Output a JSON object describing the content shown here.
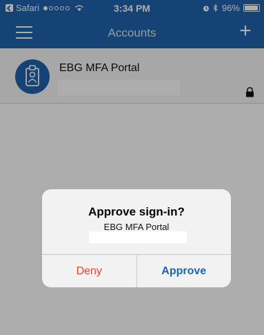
{
  "statusbar": {
    "back_app": "Safari",
    "time": "3:34 PM",
    "battery": "96%",
    "battery_level": 0.96
  },
  "navbar": {
    "title": "Accounts",
    "menu_icon": "hamburger-menu-icon",
    "add_icon": "plus-icon",
    "add_label": "+"
  },
  "account": {
    "name": "EBG MFA Portal",
    "avatar_icon": "id-badge-icon",
    "lock_icon": "lock-icon"
  },
  "dialog": {
    "title": "Approve sign-in?",
    "message": "EBG MFA Portal",
    "deny_label": "Deny",
    "approve_label": "Approve"
  },
  "colors": {
    "brand_blue": "#1f64ad",
    "deny_red": "#ff3b30"
  }
}
